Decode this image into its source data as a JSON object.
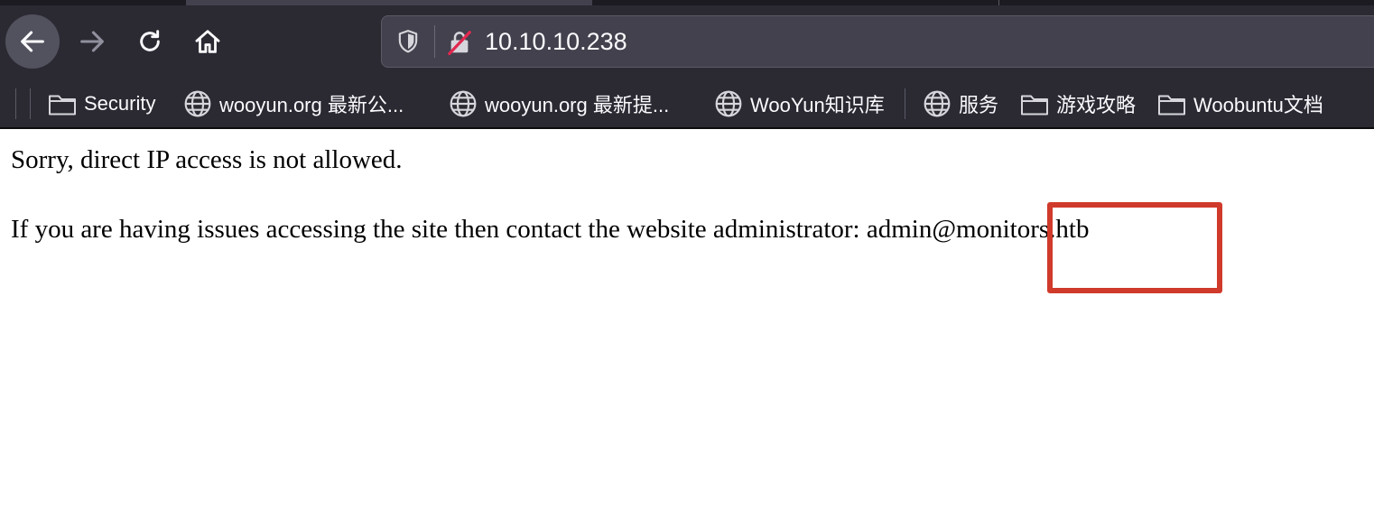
{
  "browser": {
    "url": "10.10.10.238",
    "accent_color": "#2b2a33",
    "toolbar_icons": [
      "back-icon",
      "forward-icon",
      "reload-icon",
      "home-icon",
      "shield-icon",
      "insecure-lock-icon"
    ]
  },
  "bookmarks": [
    {
      "label": "Security",
      "icon": "folder-icon"
    },
    {
      "label": "wooyun.org 最新公...",
      "icon": "globe-icon"
    },
    {
      "label": "wooyun.org 最新提...",
      "icon": "globe-icon"
    },
    {
      "label": "WooYun知识库",
      "icon": "globe-icon"
    },
    {
      "label": "服务",
      "icon": "globe-icon"
    },
    {
      "label": "游戏攻略",
      "icon": "folder-icon"
    },
    {
      "label": "Woobuntu文档",
      "icon": "folder-icon"
    }
  ],
  "page": {
    "line1": "Sorry, direct IP access is not allowed.",
    "line2": "If you are having issues accessing the site then contact the website administrator: admin@monitors.htb"
  },
  "annotation": {
    "highlight_color": "#d03a2b"
  }
}
